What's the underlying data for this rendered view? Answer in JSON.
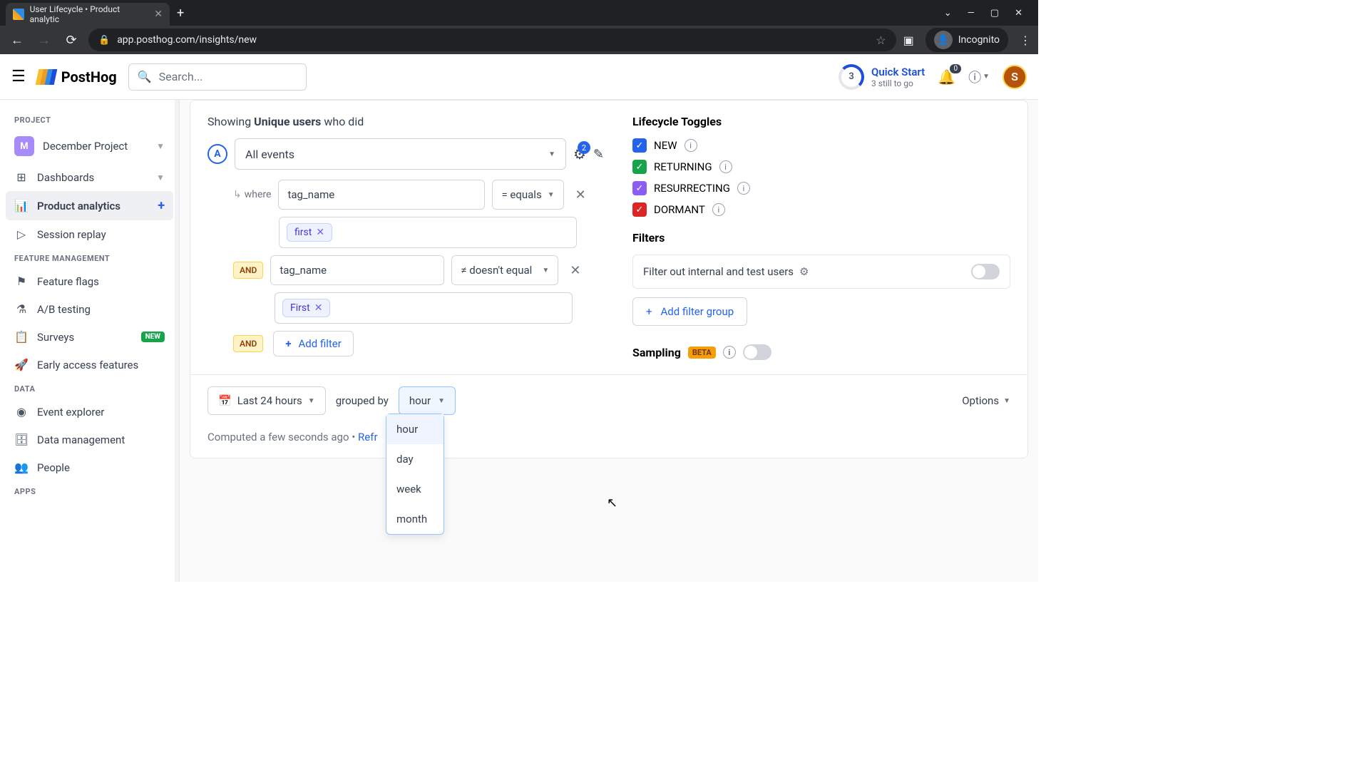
{
  "browser": {
    "tab_title": "User Lifecycle • Product analytic",
    "url": "app.posthog.com/insights/new",
    "incognito_label": "Incognito"
  },
  "header": {
    "brand": "PostHog",
    "search_placeholder": "Search...",
    "quick_start": {
      "count": "3",
      "title": "Quick Start",
      "subtitle": "3 still to go"
    },
    "notif_count": "0",
    "avatar_initial": "S"
  },
  "sidebar": {
    "sections": {
      "project": "PROJECT",
      "feature": "FEATURE MANAGEMENT",
      "data": "DATA",
      "apps": "APPS"
    },
    "project": {
      "initial": "M",
      "name": "December Project"
    },
    "items": {
      "dashboards": "Dashboards",
      "product_analytics": "Product analytics",
      "session_replay": "Session replay",
      "feature_flags": "Feature flags",
      "ab_testing": "A/B testing",
      "surveys": "Surveys",
      "surveys_badge": "NEW",
      "early_access": "Early access features",
      "event_explorer": "Event explorer",
      "data_management": "Data management",
      "people": "People"
    }
  },
  "query": {
    "showing_prefix": "Showing ",
    "showing_bold": "Unique users",
    "showing_suffix": " who did",
    "series_letter": "A",
    "event_label": "All events",
    "filter_badge_count": "2",
    "where_label": "where",
    "and_label": "AND",
    "cond1": {
      "prop": "tag_name",
      "op": "= equals",
      "value": "first"
    },
    "cond2": {
      "prop": "tag_name",
      "op": "≠ doesn't equal",
      "value": "First"
    },
    "add_filter": "Add filter"
  },
  "lifecycle": {
    "title": "Lifecycle Toggles",
    "new": "NEW",
    "returning": "RETURNING",
    "resurrecting": "RESURRECTING",
    "dormant": "DORMANT"
  },
  "filters": {
    "title": "Filters",
    "internal_label": "Filter out internal and test users",
    "add_group": "Add filter group"
  },
  "sampling": {
    "label": "Sampling",
    "badge": "BETA"
  },
  "bottom": {
    "date_label": "Last 24 hours",
    "grouped_by": "grouped by",
    "interval_selected": "hour",
    "options": "Options",
    "computed": "Computed a few seconds ago • ",
    "refresh": "Refr",
    "dropdown": [
      "hour",
      "day",
      "week",
      "month"
    ]
  }
}
